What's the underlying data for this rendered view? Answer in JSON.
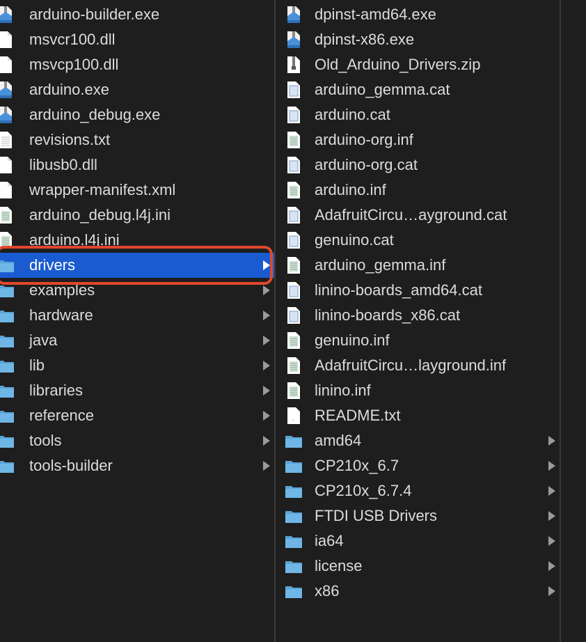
{
  "colors": {
    "background": "#1e1e1e",
    "selection": "#1a5bd1",
    "highlight_box": "#e0472d",
    "folder": "#5aa4d6"
  },
  "column1": {
    "items": [
      {
        "name": "arduino-builder.exe",
        "kind": "exe"
      },
      {
        "name": "msvcr100.dll",
        "kind": "doc"
      },
      {
        "name": "msvcp100.dll",
        "kind": "doc"
      },
      {
        "name": "arduino.exe",
        "kind": "exe"
      },
      {
        "name": "arduino_debug.exe",
        "kind": "exe"
      },
      {
        "name": "revisions.txt",
        "kind": "text"
      },
      {
        "name": "libusb0.dll",
        "kind": "doc"
      },
      {
        "name": "wrapper-manifest.xml",
        "kind": "doc"
      },
      {
        "name": "arduino_debug.l4j.ini",
        "kind": "ini"
      },
      {
        "name": "arduino.l4j.ini",
        "kind": "ini"
      },
      {
        "name": "drivers",
        "kind": "folder",
        "selected": true
      },
      {
        "name": "examples",
        "kind": "folder"
      },
      {
        "name": "hardware",
        "kind": "folder"
      },
      {
        "name": "java",
        "kind": "folder"
      },
      {
        "name": "lib",
        "kind": "folder"
      },
      {
        "name": "libraries",
        "kind": "folder"
      },
      {
        "name": "reference",
        "kind": "folder"
      },
      {
        "name": "tools",
        "kind": "folder"
      },
      {
        "name": "tools-builder",
        "kind": "folder"
      }
    ]
  },
  "column2": {
    "items": [
      {
        "name": "dpinst-amd64.exe",
        "kind": "exe"
      },
      {
        "name": "dpinst-x86.exe",
        "kind": "exe"
      },
      {
        "name": "Old_Arduino_Drivers.zip",
        "kind": "zip"
      },
      {
        "name": "arduino_gemma.cat",
        "kind": "cat"
      },
      {
        "name": "arduino.cat",
        "kind": "cat"
      },
      {
        "name": "arduino-org.inf",
        "kind": "ini"
      },
      {
        "name": "arduino-org.cat",
        "kind": "cat"
      },
      {
        "name": "arduino.inf",
        "kind": "ini"
      },
      {
        "name": "AdafruitCircu…ayground.cat",
        "kind": "cat"
      },
      {
        "name": "genuino.cat",
        "kind": "cat"
      },
      {
        "name": "arduino_gemma.inf",
        "kind": "ini"
      },
      {
        "name": "linino-boards_amd64.cat",
        "kind": "cat"
      },
      {
        "name": "linino-boards_x86.cat",
        "kind": "cat"
      },
      {
        "name": "genuino.inf",
        "kind": "ini"
      },
      {
        "name": "AdafruitCircu…layground.inf",
        "kind": "ini"
      },
      {
        "name": "linino.inf",
        "kind": "ini"
      },
      {
        "name": "README.txt",
        "kind": "readme"
      },
      {
        "name": "amd64",
        "kind": "folder"
      },
      {
        "name": "CP210x_6.7",
        "kind": "folder"
      },
      {
        "name": "CP210x_6.7.4",
        "kind": "folder"
      },
      {
        "name": "FTDI USB Drivers",
        "kind": "folder"
      },
      {
        "name": "ia64",
        "kind": "folder"
      },
      {
        "name": "license",
        "kind": "folder"
      },
      {
        "name": "x86",
        "kind": "folder"
      }
    ]
  }
}
